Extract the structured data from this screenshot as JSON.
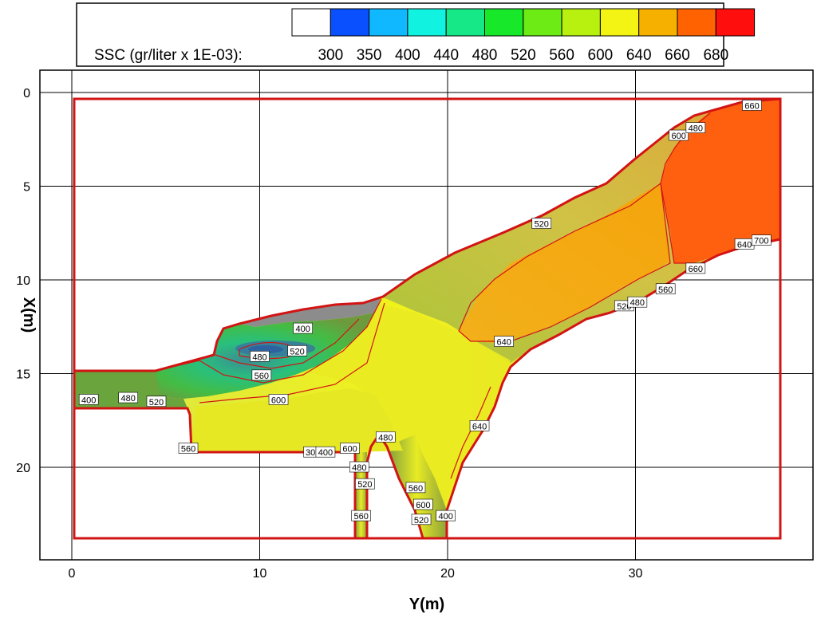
{
  "chart_data": {
    "type": "heatmap",
    "title": "",
    "xlabel": "Y(m)",
    "ylabel": "X(m)",
    "x_axis": {
      "min": 0,
      "max": 40,
      "ticks": [
        0,
        10,
        20,
        30
      ],
      "tick_labels": [
        "0",
        "10",
        "20",
        "30"
      ]
    },
    "y_axis": {
      "min": 0,
      "max": 24.7,
      "inverted": true,
      "ticks": [
        0,
        5,
        10,
        15,
        20
      ],
      "tick_labels": [
        "0",
        "5",
        "10",
        "15",
        "20"
      ]
    },
    "grid": true,
    "legend": {
      "position": "top",
      "label": "SSC (gr/liter x 1E-03):",
      "levels": [
        300,
        350,
        400,
        440,
        480,
        520,
        560,
        600,
        640,
        660,
        680
      ],
      "level_labels": [
        "300",
        "350",
        "400",
        "440",
        "480",
        "520",
        "560",
        "600",
        "640",
        "660",
        "680"
      ],
      "colors": [
        "#ffffff",
        "#0a50ff",
        "#10b8ff",
        "#12f2e0",
        "#16e888",
        "#18e82a",
        "#6cec14",
        "#b8f010",
        "#f4f414",
        "#f6b000",
        "#ff6200",
        "#ff0e0e"
      ]
    },
    "boundary_color": "#d21414",
    "contour_labels": [
      {
        "text": "660",
        "x": 36.2,
        "y": 0.7
      },
      {
        "text": "600",
        "x": 32.3,
        "y": 2.3
      },
      {
        "text": "480",
        "x": 33.2,
        "y": 1.9
      },
      {
        "text": "520",
        "x": 25.0,
        "y": 7.0
      },
      {
        "text": "640",
        "x": 35.8,
        "y": 8.1
      },
      {
        "text": "700",
        "x": 36.7,
        "y": 7.9
      },
      {
        "text": "660",
        "x": 33.2,
        "y": 9.4
      },
      {
        "text": "560",
        "x": 31.6,
        "y": 10.5
      },
      {
        "text": "520",
        "x": 29.4,
        "y": 11.4
      },
      {
        "text": "480",
        "x": 30.1,
        "y": 11.2
      },
      {
        "text": "640",
        "x": 23.0,
        "y": 13.3
      },
      {
        "text": "400",
        "x": 12.3,
        "y": 12.6
      },
      {
        "text": "520",
        "x": 12.0,
        "y": 13.8
      },
      {
        "text": "480",
        "x": 10.0,
        "y": 14.1
      },
      {
        "text": "560",
        "x": 10.1,
        "y": 15.1
      },
      {
        "text": "600",
        "x": 11.0,
        "y": 16.4
      },
      {
        "text": "400",
        "x": 0.9,
        "y": 16.4
      },
      {
        "text": "480",
        "x": 3.0,
        "y": 16.3
      },
      {
        "text": "520",
        "x": 4.5,
        "y": 16.5
      },
      {
        "text": "560",
        "x": 6.2,
        "y": 19.0
      },
      {
        "text": "640",
        "x": 21.7,
        "y": 17.8
      },
      {
        "text": "30",
        "x": 12.7,
        "y": 19.2
      },
      {
        "text": "400",
        "x": 13.5,
        "y": 19.2
      },
      {
        "text": "600",
        "x": 14.8,
        "y": 19.0
      },
      {
        "text": "480",
        "x": 16.7,
        "y": 18.4
      },
      {
        "text": "480",
        "x": 15.3,
        "y": 20.0
      },
      {
        "text": "520",
        "x": 15.6,
        "y": 20.9
      },
      {
        "text": "560",
        "x": 15.4,
        "y": 22.6
      },
      {
        "text": "560",
        "x": 18.3,
        "y": 21.1
      },
      {
        "text": "600",
        "x": 18.7,
        "y": 22.0
      },
      {
        "text": "520",
        "x": 18.6,
        "y": 22.8
      },
      {
        "text": "400",
        "x": 19.9,
        "y": 22.6
      }
    ]
  }
}
